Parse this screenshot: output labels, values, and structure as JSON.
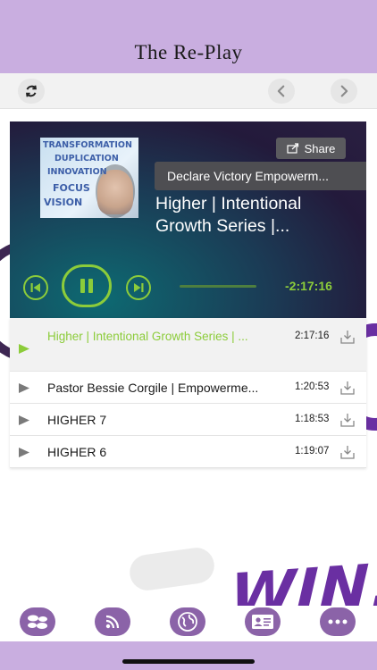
{
  "header": {
    "title": "The Re-Play"
  },
  "toolbar": {
    "refresh_icon": "refresh-icon",
    "back_icon": "chevron-left-icon",
    "forward_icon": "chevron-right-icon"
  },
  "background": {
    "win_text": "WIN!"
  },
  "player": {
    "cover_lines": [
      "TRANSFORMATION",
      "DUPLICATION",
      "INNOVATION",
      "FOCUS",
      "VISION"
    ],
    "share_label": "Share",
    "episode_chip": "Declare Victory Empowerm...",
    "now_playing_title": "Higher | Intentional Growth Series |...",
    "remaining_time": "-2:17:16",
    "progress": 0.0,
    "accent_color": "#8ccc3a"
  },
  "playlist": [
    {
      "title": "Higher | Intentional Growth Series | ...",
      "duration": "2:17:16",
      "active": true
    },
    {
      "title": "Pastor Bessie Corgile | Empowerme...",
      "duration": "1:20:53",
      "active": false
    },
    {
      "title": "HIGHER 7",
      "duration": "1:18:53",
      "active": false
    },
    {
      "title": "HIGHER 6",
      "duration": "1:19:07",
      "active": false
    }
  ],
  "tabbar": {
    "tabs": [
      {
        "icon": "circles-icon"
      },
      {
        "icon": "rss-icon"
      },
      {
        "icon": "globe-icon"
      },
      {
        "icon": "contact-card-icon"
      },
      {
        "icon": "more-icon"
      }
    ],
    "tab_color": "#8b63a8"
  },
  "colors": {
    "header_bg": "#c9aee0",
    "accent_green": "#8ccc3a",
    "brand_purple": "#6a2fa2"
  }
}
